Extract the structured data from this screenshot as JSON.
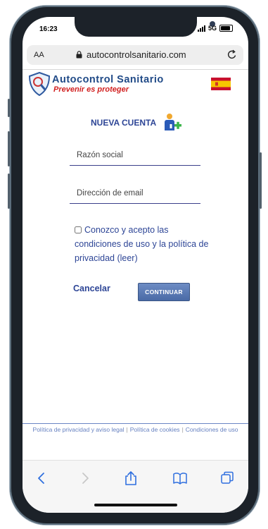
{
  "status_bar": {
    "time": "16:23",
    "network": "5G"
  },
  "browser": {
    "text_size_label": "AA",
    "url": "autocontrolsanitario.com"
  },
  "site_header": {
    "brand": "Autocontrol Sanitario",
    "tagline": "Prevenir es proteger",
    "language_flag": "spain-flag-icon"
  },
  "form": {
    "title": "NUEVA CUENTA",
    "company_placeholder": "Razón social",
    "email_placeholder": "Dirección de email",
    "terms_label": "Conozco y acepto las condiciones de uso y la política de privacidad (leer)",
    "cancel_label": "Cancelar",
    "continue_label": "CONTINUAR"
  },
  "footer": {
    "links": [
      "Política de privacidad y aviso legal",
      "Política de cookies",
      "Condiciones de uso"
    ],
    "separator": "|"
  },
  "colors": {
    "brand_blue": "#204a87",
    "tagline_red": "#d12020",
    "form_blue": "#2d4596",
    "safari_blue": "#2f6fdf"
  }
}
